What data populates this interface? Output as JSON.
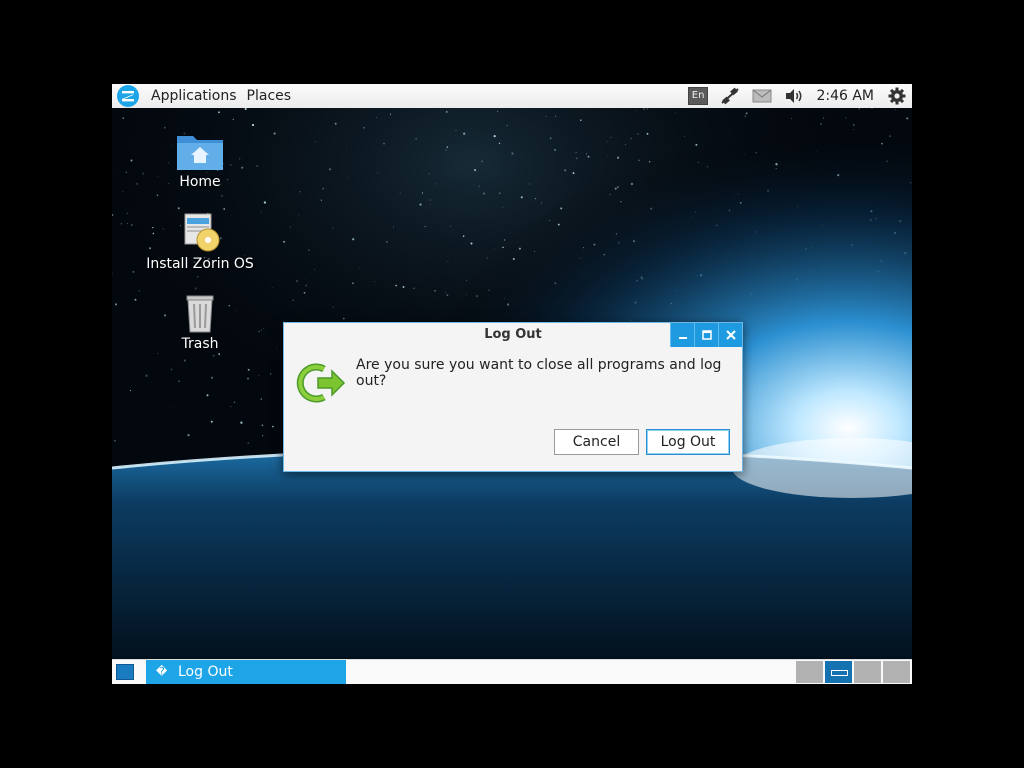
{
  "top_panel": {
    "logo_icon": "zorin-logo-icon",
    "menus": [
      "Applications",
      "Places"
    ],
    "tray": {
      "language": "En",
      "network_icon": "network-wired-icon",
      "mail_icon": "mail-icon",
      "volume_icon": "volume-icon",
      "clock": "2:46 AM",
      "settings_icon": "gear-icon"
    }
  },
  "desktop": {
    "icons": [
      {
        "label": "Home",
        "icon": "home-folder-icon"
      },
      {
        "label": "Install Zorin OS",
        "icon": "installer-icon"
      },
      {
        "label": "Trash",
        "icon": "trash-icon"
      }
    ]
  },
  "dialog": {
    "title": "Log Out",
    "message": "Are you sure you want to close all programs and log out?",
    "icon": "logout-arrow-icon",
    "buttons": {
      "cancel": "Cancel",
      "logout": "Log Out"
    },
    "controls": [
      "minimize",
      "maximize",
      "close"
    ],
    "accent_color": "#1e9be0"
  },
  "bottom_panel": {
    "show_desktop_icon": "show-desktop-icon",
    "tasks": [
      {
        "label": "Log Out",
        "icon": "�",
        "active": true
      }
    ],
    "workspaces": [
      false,
      true,
      false,
      false
    ]
  }
}
